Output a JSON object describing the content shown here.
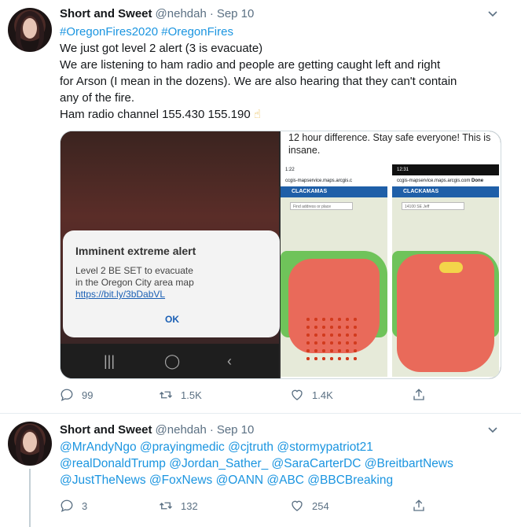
{
  "tweets": [
    {
      "name": "Short and Sweet",
      "handle": "@nehdah",
      "dot": "·",
      "time": "Sep 10",
      "lines": [
        "#OregonFires2020 #OregonFires",
        "We just got level 2 alert (3 is evacuate)",
        "We are listening to ham radio and people are getting caught left and right",
        "for Arson (I mean in the dozens). We are also hearing that they can't contain",
        "any of the fire.",
        "Ham radio channel 155.430 155.190"
      ],
      "emoji": "☝",
      "media": {
        "alert_title": "Imminent extreme alert",
        "alert_message_line1": "Level 2 BE SET to evacuate",
        "alert_message_line2": "in the Oregon City area map",
        "alert_link": "https://bit.ly/3bDabVL",
        "alert_ok": "OK",
        "caption": "12 hour difference. Stay safe everyone! This is insane.",
        "phone1": {
          "time": "1:22",
          "url": "ccgis-mapservice.maps.arcgis.c",
          "app": "CLACKAMAS",
          "search": "Find address or place"
        },
        "phone2": {
          "time": "12:31",
          "url": "ccgis-mapservice.maps.arcgis.com",
          "done": "Done",
          "app": "CLACKAMAS",
          "search": "14100 SE Jeff"
        }
      },
      "actions": {
        "reply": "99",
        "retweet": "1.5K",
        "like": "1.4K"
      }
    },
    {
      "name": "Short and Sweet",
      "handle": "@nehdah",
      "dot": "·",
      "time": "Sep 10",
      "mention_lines": [
        "@MrAndyNgo @prayingmedic @cjtruth @stormypatriot21",
        "@realDonaldTrump @Jordan_Sather_ @SaraCarterDC @BreitbartNews",
        "@JustTheNews @FoxNews @OANN @ABC @BBCBreaking"
      ],
      "actions": {
        "reply": "3",
        "retweet": "132",
        "like": "254"
      }
    }
  ],
  "colors": {
    "link": "#1b95e0",
    "muted": "#5b7083",
    "border": "#e6ecf0",
    "accent_blue": "#1f5fa8"
  }
}
